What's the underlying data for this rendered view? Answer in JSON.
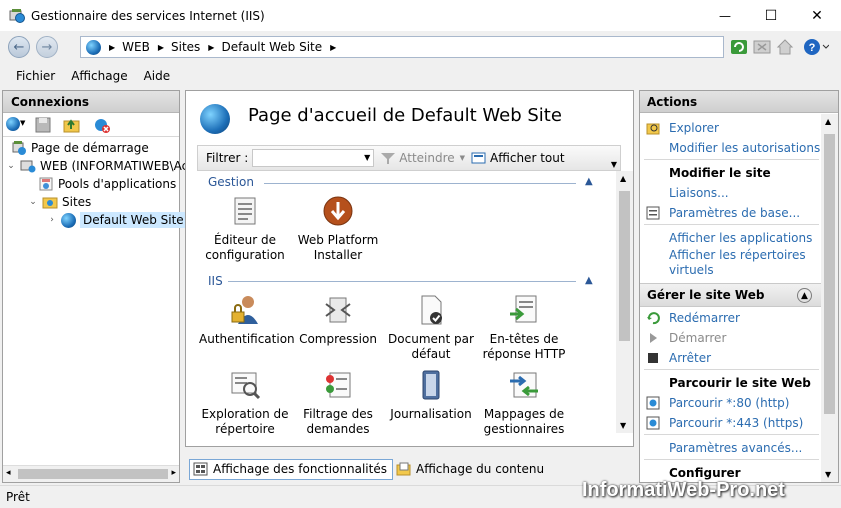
{
  "window": {
    "title": "Gestionnaire des services Internet (IIS)",
    "minimize_glyph": "—",
    "maximize_glyph": "☐",
    "close_glyph": "✕"
  },
  "address": {
    "crumbs": [
      "WEB",
      "Sites",
      "Default Web Site"
    ],
    "back_glyph": "←",
    "forward_glyph": "→"
  },
  "menu": [
    "Fichier",
    "Affichage",
    "Aide"
  ],
  "connections": {
    "title": "Connexions",
    "tree": [
      {
        "label": "Page de démarrage"
      },
      {
        "label": "WEB (INFORMATIWEB\\Ac"
      },
      {
        "label": "Pools d'applications"
      },
      {
        "label": "Sites"
      },
      {
        "label": "Default Web Site"
      }
    ]
  },
  "center": {
    "title": "Page d'accueil de Default Web Site",
    "filter_label": "Filtrer :",
    "filter_value": "",
    "go_label": "Atteindre",
    "show_all_label": "Afficher tout",
    "groups": [
      {
        "name": "Gestion",
        "features": [
          {
            "line1": "Éditeur de",
            "line2": "configuration",
            "icon": "config-editor-icon"
          },
          {
            "line1": "Web Platform",
            "line2": "Installer",
            "icon": "web-platform-installer-icon"
          }
        ]
      },
      {
        "name": "IIS",
        "features": [
          {
            "line1": "Authentification",
            "line2": "",
            "icon": "authentication-icon"
          },
          {
            "line1": "Compression",
            "line2": "",
            "icon": "compression-icon"
          },
          {
            "line1": "Document par",
            "line2": "défaut",
            "icon": "default-document-icon"
          },
          {
            "line1": "En-têtes de",
            "line2": "réponse HTTP",
            "icon": "http-headers-icon"
          },
          {
            "line1": "Exploration de",
            "line2": "répertoire",
            "icon": "directory-browsing-icon"
          },
          {
            "line1": "Filtrage des",
            "line2": "demandes",
            "icon": "request-filtering-icon"
          },
          {
            "line1": "Journalisation",
            "line2": "",
            "icon": "logging-icon"
          },
          {
            "line1": "Mappages de",
            "line2": "gestionnaires",
            "icon": "handler-mappings-icon"
          }
        ]
      }
    ],
    "view_features": "Affichage des fonctionnalités",
    "view_content": "Affichage du contenu"
  },
  "actions": {
    "title": "Actions",
    "explore": "Explorer",
    "edit_permissions": "Modifier les autorisations...",
    "edit_site_title": "Modifier le site",
    "bindings": "Liaisons...",
    "basic_settings": "Paramètres de base...",
    "view_applications": "Afficher les applications",
    "view_vdirs_1": "Afficher les répertoires",
    "view_vdirs_2": "virtuels",
    "manage_site_title": "Gérer le site Web",
    "restart": "Redémarrer",
    "start": "Démarrer",
    "stop": "Arrêter",
    "browse_title": "Parcourir le site Web",
    "browse_http": "Parcourir *:80 (http)",
    "browse_https": "Parcourir *:443 (https)",
    "advanced_settings": "Paramètres avancés...",
    "configure_title": "Configurer"
  },
  "status": {
    "text": "Prêt"
  },
  "watermark": "InformatiWeb-Pro.net"
}
